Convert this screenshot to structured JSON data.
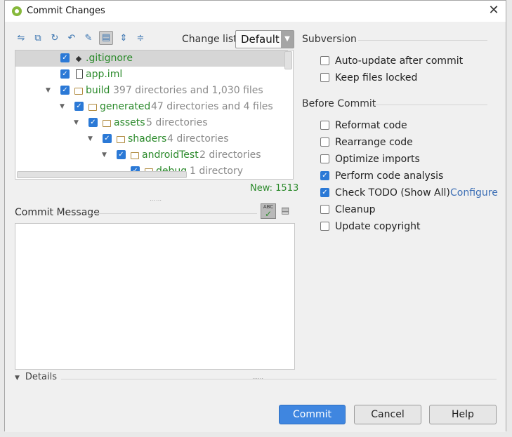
{
  "window": {
    "title": "Commit Changes",
    "close_glyph": "✕"
  },
  "toolbar": {
    "change_list_label": "Change list:",
    "change_list_value": "Default"
  },
  "tree": {
    "rows": [
      {
        "name": ".gitignore",
        "detail": ""
      },
      {
        "name": "app.iml",
        "detail": ""
      },
      {
        "name": "build",
        "detail": "397 directories and 1,030 files"
      },
      {
        "name": "generated",
        "detail": "47 directories and 4 files"
      },
      {
        "name": "assets",
        "detail": "5 directories"
      },
      {
        "name": "shaders",
        "detail": "4 directories"
      },
      {
        "name": "androidTest",
        "detail": "2 directories"
      },
      {
        "name": "debug",
        "detail": "1 directory"
      }
    ],
    "new_count": "New: 1513"
  },
  "commit_message": {
    "label": "Commit Message",
    "value": ""
  },
  "subversion": {
    "title": "Subversion",
    "options": [
      {
        "label": "Auto-update after commit",
        "checked": false
      },
      {
        "label": "Keep files locked",
        "checked": false
      }
    ]
  },
  "before_commit": {
    "title": "Before Commit",
    "options": [
      {
        "label": "Reformat code",
        "checked": false
      },
      {
        "label": "Rearrange code",
        "checked": false
      },
      {
        "label": "Optimize imports",
        "checked": false
      },
      {
        "label": "Perform code analysis",
        "checked": true
      },
      {
        "label": "Check TODO (Show All)",
        "checked": true,
        "link": "Configure"
      },
      {
        "label": "Cleanup",
        "checked": false
      },
      {
        "label": "Update copyright",
        "checked": false
      }
    ]
  },
  "details": {
    "label": "Details"
  },
  "buttons": {
    "commit": "Commit",
    "cancel": "Cancel",
    "help": "Help"
  },
  "colors": {
    "accent": "#2b79d6",
    "primary_button": "#3f86e0",
    "new_file_green": "#2b8a2b",
    "link": "#3d6fb5"
  }
}
